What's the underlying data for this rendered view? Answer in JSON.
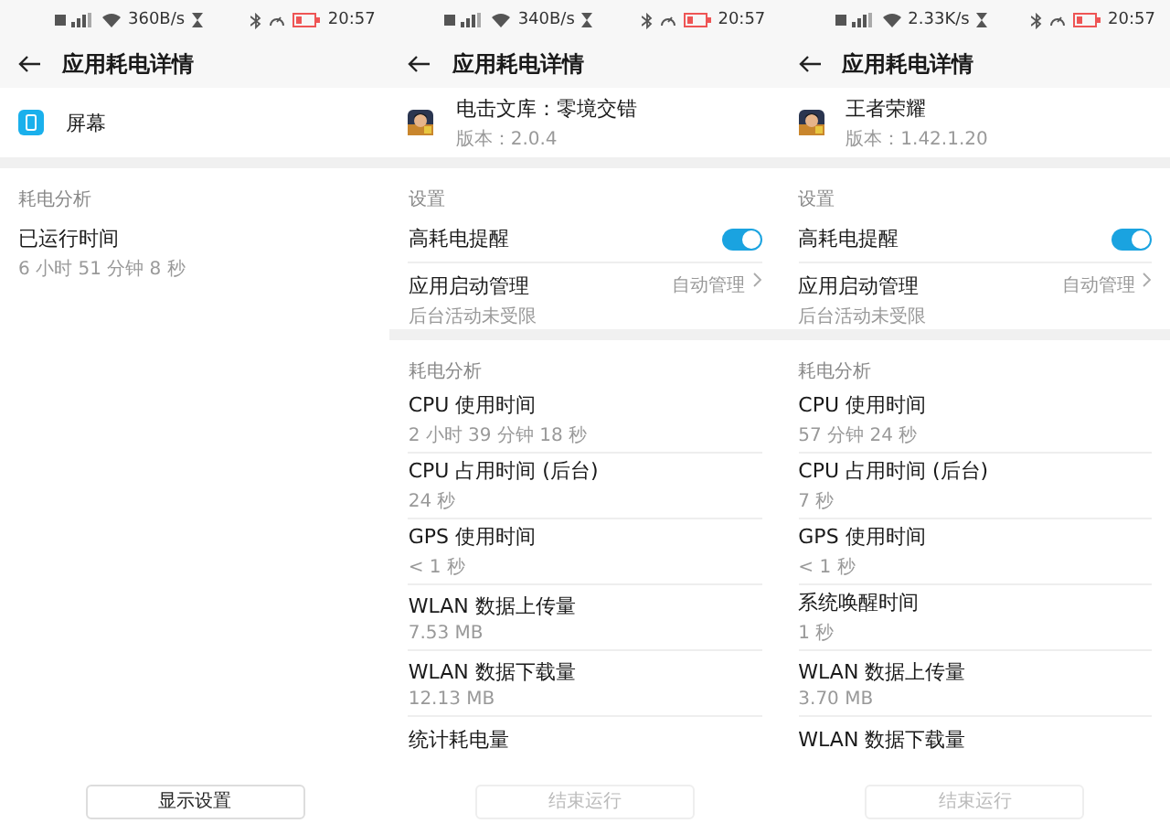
{
  "panes": [
    {
      "status_bar": {
        "speed": "360B/s",
        "time": "20:57"
      },
      "title": "应用耗电详情",
      "app": {
        "kind": "screen",
        "name": "屏幕"
      },
      "sections": [
        {
          "label": "耗电分析",
          "rows": [
            {
              "kind": "info",
              "title": "已运行时间",
              "value": "6 小时 51 分钟 8 秒"
            }
          ]
        }
      ],
      "button": {
        "label": "显示设置",
        "disabled": false
      }
    },
    {
      "status_bar": {
        "speed": "340B/s",
        "time": "20:57"
      },
      "title": "应用耗电详情",
      "app": {
        "kind": "picture",
        "name": "电击文库：零境交错",
        "version": "版本：2.0.4"
      },
      "sections": [
        {
          "label": "设置",
          "rows": [
            {
              "kind": "toggle",
              "title": "高耗电提醒",
              "on": true
            },
            {
              "kind": "link",
              "title": "应用启动管理",
              "value": "后台活动未受限",
              "detail": "自动管理"
            }
          ]
        },
        {
          "label": "耗电分析",
          "rows": [
            {
              "kind": "info",
              "title": "CPU 使用时间",
              "value": "2 小时 39 分钟 18 秒"
            },
            {
              "kind": "info",
              "title": "CPU 占用时间 (后台)",
              "value": "24 秒"
            },
            {
              "kind": "info",
              "title": "GPS 使用时间",
              "value": "< 1 秒"
            },
            {
              "kind": "info",
              "title": "WLAN 数据上传量",
              "value": "7.53 MB"
            },
            {
              "kind": "info",
              "title": "WLAN 数据下载量",
              "value": "12.13 MB"
            },
            {
              "kind": "info",
              "title": "统计耗电量"
            }
          ]
        }
      ],
      "button": {
        "label": "结束运行",
        "disabled": true
      }
    },
    {
      "status_bar": {
        "speed": "2.33K/s",
        "time": "20:57"
      },
      "title": "应用耗电详情",
      "app": {
        "kind": "picture",
        "name": "王者荣耀",
        "version": "版本：1.42.1.20"
      },
      "sections": [
        {
          "label": "设置",
          "rows": [
            {
              "kind": "toggle",
              "title": "高耗电提醒",
              "on": true
            },
            {
              "kind": "link",
              "title": "应用启动管理",
              "value": "后台活动未受限",
              "detail": "自动管理"
            }
          ]
        },
        {
          "label": "耗电分析",
          "rows": [
            {
              "kind": "info",
              "title": "CPU 使用时间",
              "value": "57 分钟 24 秒"
            },
            {
              "kind": "info",
              "title": "CPU 占用时间 (后台)",
              "value": "7 秒"
            },
            {
              "kind": "info",
              "title": "GPS 使用时间",
              "value": "< 1 秒"
            },
            {
              "kind": "info",
              "title": "系统唤醒时间",
              "value": "1 秒"
            },
            {
              "kind": "info",
              "title": "WLAN 数据上传量",
              "value": "3.70 MB"
            },
            {
              "kind": "info",
              "title": "WLAN 数据下载量"
            }
          ]
        }
      ],
      "button": {
        "label": "结束运行",
        "disabled": true
      }
    }
  ]
}
